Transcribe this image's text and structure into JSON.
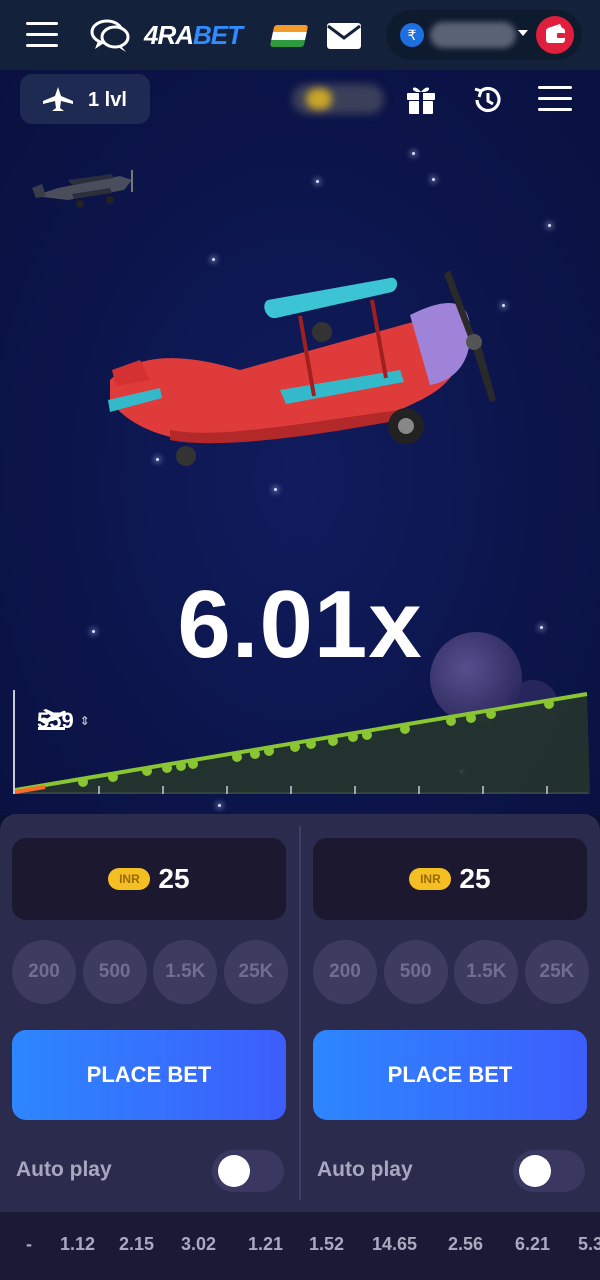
{
  "header": {
    "brand_prefix": "4RA",
    "brand_suffix": "BET",
    "currency_symbol": "₹",
    "colors": {
      "nav_bg": "#13223a",
      "brand_accent": "#2f8bff",
      "wallet": "#e01f3d"
    },
    "icons": [
      "menu-icon",
      "chat-icon",
      "flag-india-icon",
      "mail-icon",
      "rupee-icon",
      "wallet-icon"
    ]
  },
  "game": {
    "level_label": "1 lvl",
    "multiplier": "6.01x",
    "players_count": "559",
    "icons": [
      "plane-icon",
      "gift-icon",
      "history-icon",
      "menu-icon",
      "takeoff-icon"
    ]
  },
  "bets": [
    {
      "currency_badge": "INR",
      "amount": "25",
      "chips": [
        "200",
        "500",
        "1.5K",
        "25K"
      ],
      "place_bet_label": "PLACE BET",
      "autoplay_label": "Auto play",
      "autoplay_on": false
    },
    {
      "currency_badge": "INR",
      "amount": "25",
      "chips": [
        "200",
        "500",
        "1.5K",
        "25K"
      ],
      "place_bet_label": "PLACE BET",
      "autoplay_label": "Auto play",
      "autoplay_on": false
    }
  ],
  "history": [
    "-",
    "1.12",
    "2.15",
    "3.02",
    "1.21",
    "1.52",
    "14.65",
    "2.56",
    "6.21",
    "5.3"
  ]
}
